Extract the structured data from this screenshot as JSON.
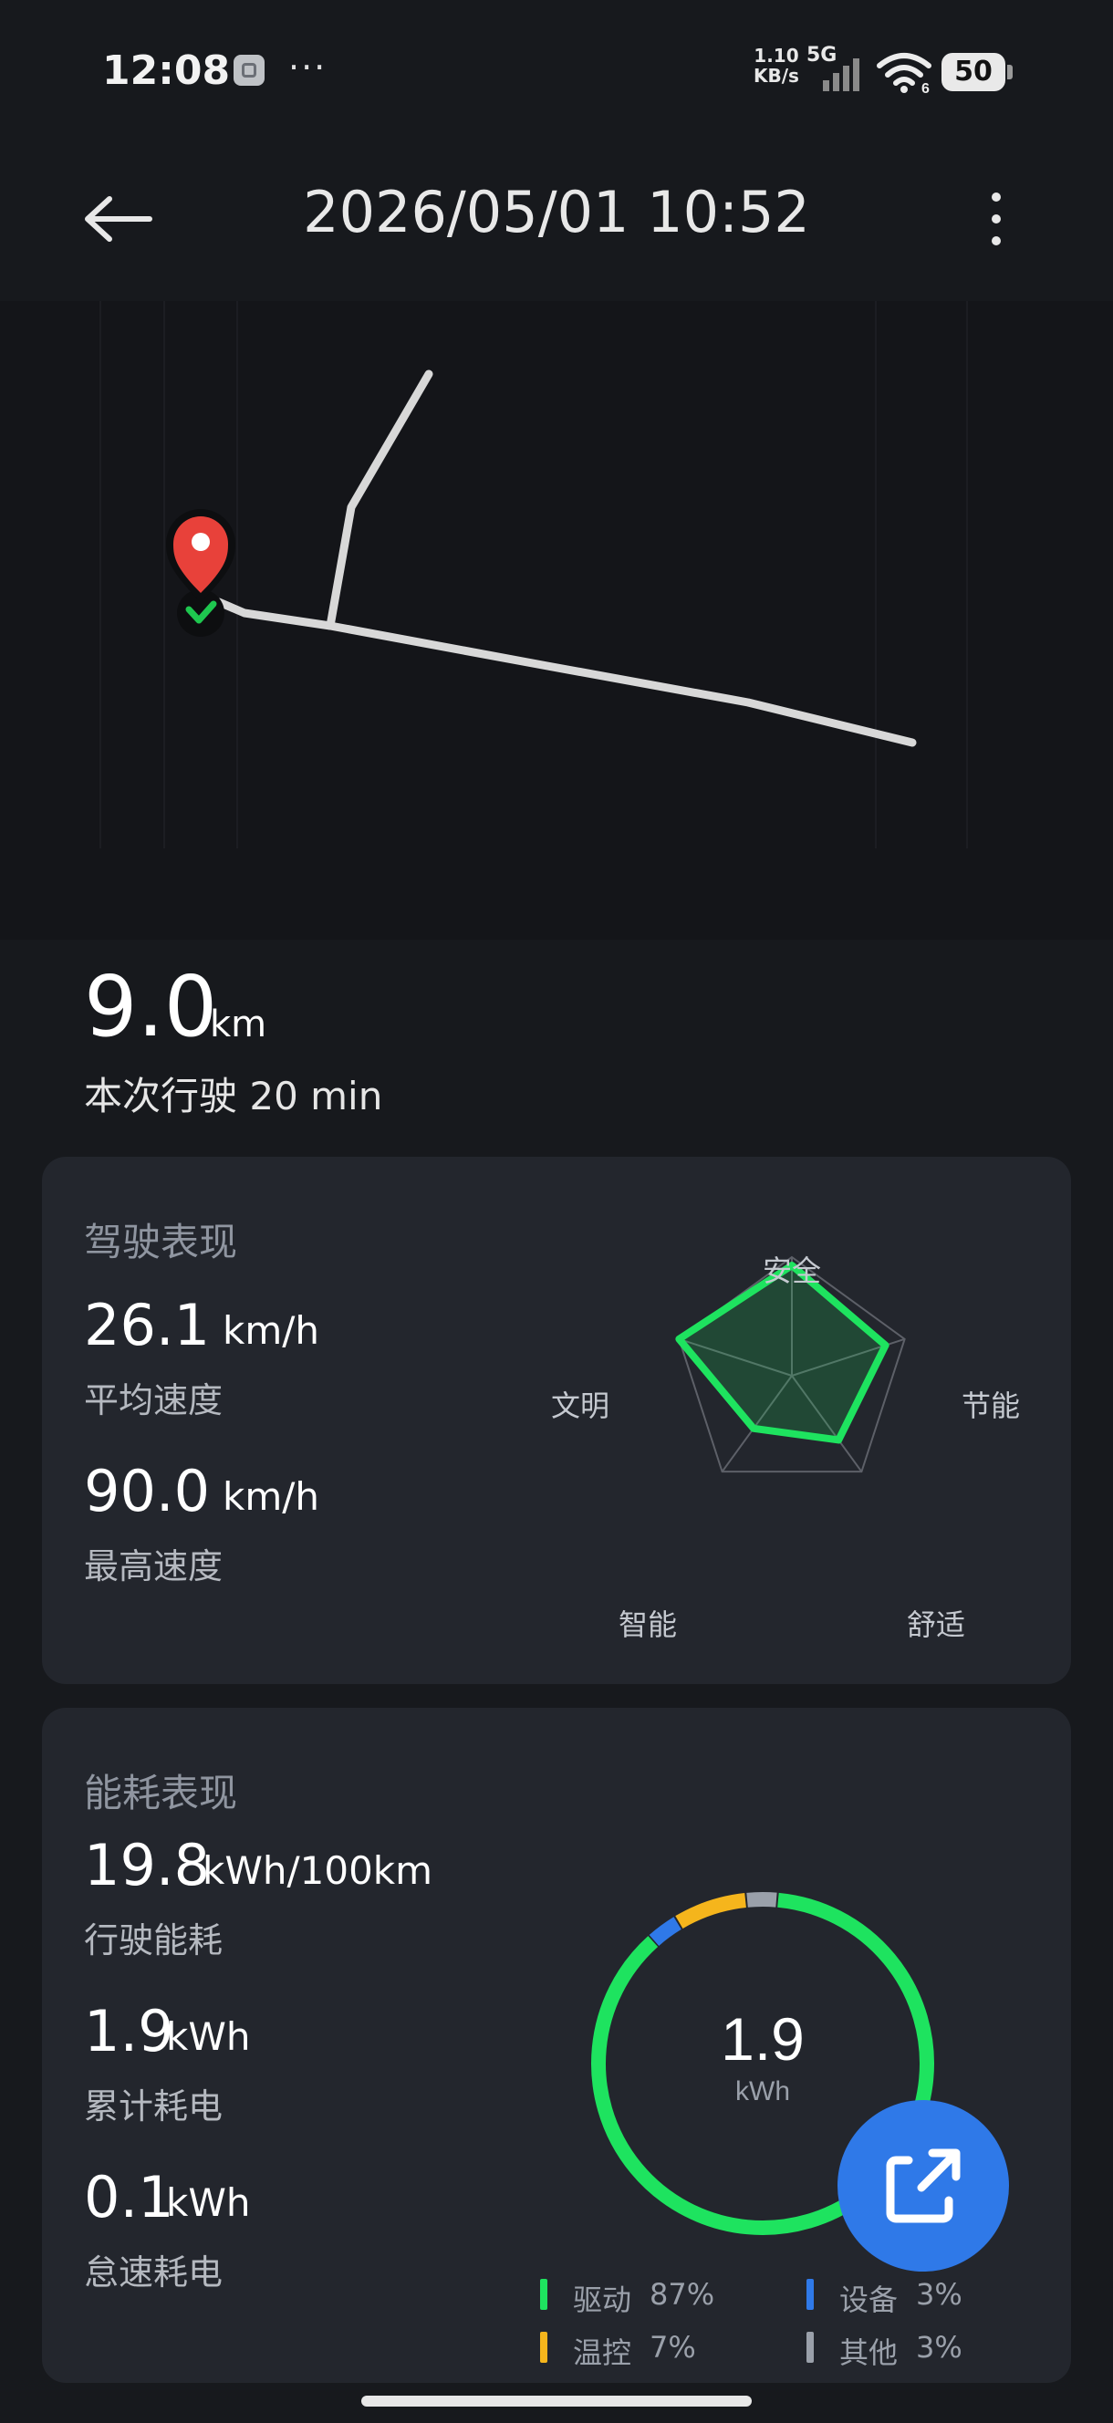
{
  "status_bar": {
    "time": "12:08",
    "more": "···",
    "net_speed_value": "1.10",
    "net_speed_unit": "KB/s",
    "network": "5G",
    "wifi_badge": "6",
    "battery": "50"
  },
  "header": {
    "title": "2026/05/01 10:52"
  },
  "trip": {
    "distance_value": "9.0",
    "distance_unit": "km",
    "duration": "本次行驶 20 min"
  },
  "driving": {
    "title": "驾驶表现",
    "avg_speed_value": "26.1",
    "avg_speed_unit": "km/h",
    "avg_speed_label": "平均速度",
    "max_speed_value": "90.0",
    "max_speed_unit": "km/h",
    "max_speed_label": "最高速度",
    "radar_labels": {
      "safety": "安全",
      "economy": "节能",
      "comfort": "舒适",
      "smart": "智能",
      "civility": "文明"
    },
    "radar_values": {
      "safety": 0.93,
      "economy": 0.83,
      "comfort": 0.67,
      "smart": 0.55,
      "civility": 1.0
    },
    "accent_color": "#1ee35f"
  },
  "energy": {
    "title": "能耗表现",
    "consumption_value": "19.8",
    "consumption_unit": "kWh/100km",
    "consumption_label": "行驶能耗",
    "total_value": "1.9",
    "total_unit": "kWh",
    "total_label": "累计耗电",
    "idle_value": "0.1",
    "idle_unit": "kWh",
    "idle_label": "怠速耗电",
    "donut_value": "1.9",
    "donut_unit": "kWh",
    "legend": [
      {
        "name": "驱动",
        "pct": "87%",
        "color": "#1ee35f"
      },
      {
        "name": "设备",
        "pct": "3%",
        "color": "#2f79e8"
      },
      {
        "name": "温控",
        "pct": "7%",
        "color": "#f5b51c"
      },
      {
        "name": "其他",
        "pct": "3%",
        "color": "#9aa0aa"
      }
    ]
  },
  "share_icon": "share-out-icon"
}
